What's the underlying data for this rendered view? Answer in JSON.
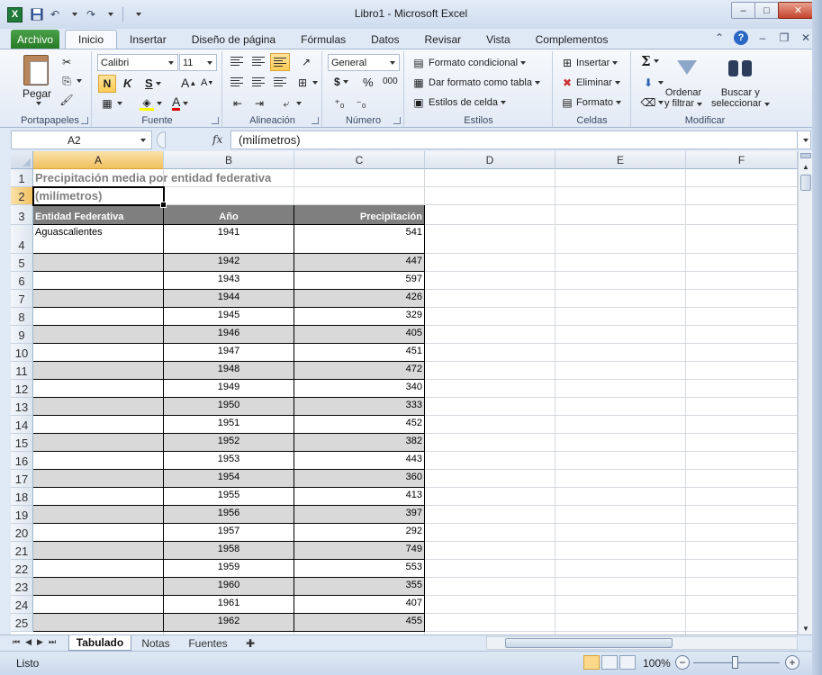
{
  "window": {
    "title": "Libro1  -  Microsoft Excel",
    "app_icon": "X"
  },
  "qat": {
    "save": "save-icon",
    "undo": "undo-icon",
    "redo": "redo-icon",
    "customize": "customize-icon"
  },
  "window_controls": {
    "minimize": "–",
    "maximize": "□",
    "close": "✕"
  },
  "tabs": [
    {
      "label": "Archivo"
    },
    {
      "label": "Inicio"
    },
    {
      "label": "Insertar"
    },
    {
      "label": "Diseño de página"
    },
    {
      "label": "Fórmulas"
    },
    {
      "label": "Datos"
    },
    {
      "label": "Revisar"
    },
    {
      "label": "Vista"
    },
    {
      "label": "Complementos"
    }
  ],
  "ribbon": {
    "clipboard": {
      "label": "Portapapeles",
      "paste": "Pegar"
    },
    "font": {
      "label": "Fuente",
      "name": "Calibri",
      "size": "11",
      "bold": "N",
      "italic": "K",
      "underline": "S",
      "grow": "A",
      "shrink": "A",
      "color_letter": "A"
    },
    "alignment": {
      "label": "Alineación"
    },
    "number": {
      "label": "Número",
      "format": "General",
      "currency": "$",
      "percent": "%",
      "thousands": "000"
    },
    "styles": {
      "label": "Estilos",
      "conditional": "Formato condicional",
      "as_table": "Dar formato como tabla",
      "cell_styles": "Estilos de celda"
    },
    "cells": {
      "label": "Celdas",
      "insert": "Insertar",
      "delete": "Eliminar",
      "format": "Formato"
    },
    "editing": {
      "label": "Modificar",
      "sort_1": "Ordenar",
      "sort_2": "y filtrar",
      "find_1": "Buscar y",
      "find_2": "seleccionar",
      "sigma": "Σ"
    }
  },
  "formula_bar": {
    "name_box": "A2",
    "fx": "fx",
    "content": "(milímetros)"
  },
  "columns": [
    "A",
    "B",
    "C",
    "D",
    "E",
    "F"
  ],
  "sheet": {
    "title": "Precipitación media por entidad federativa",
    "subtitle": "(milímetros)",
    "headers": [
      "Entidad Federativa",
      "Año",
      "Precipitación"
    ],
    "rows": [
      {
        "entity": "Aguascalientes",
        "year": "1941",
        "value": "541"
      },
      {
        "entity": "",
        "year": "1942",
        "value": "447"
      },
      {
        "entity": "",
        "year": "1943",
        "value": "597"
      },
      {
        "entity": "",
        "year": "1944",
        "value": "426"
      },
      {
        "entity": "",
        "year": "1945",
        "value": "329"
      },
      {
        "entity": "",
        "year": "1946",
        "value": "405"
      },
      {
        "entity": "",
        "year": "1947",
        "value": "451"
      },
      {
        "entity": "",
        "year": "1948",
        "value": "472"
      },
      {
        "entity": "",
        "year": "1949",
        "value": "340"
      },
      {
        "entity": "",
        "year": "1950",
        "value": "333"
      },
      {
        "entity": "",
        "year": "1951",
        "value": "452"
      },
      {
        "entity": "",
        "year": "1952",
        "value": "382"
      },
      {
        "entity": "",
        "year": "1953",
        "value": "443"
      },
      {
        "entity": "",
        "year": "1954",
        "value": "360"
      },
      {
        "entity": "",
        "year": "1955",
        "value": "413"
      },
      {
        "entity": "",
        "year": "1956",
        "value": "397"
      },
      {
        "entity": "",
        "year": "1957",
        "value": "292"
      },
      {
        "entity": "",
        "year": "1958",
        "value": "749"
      },
      {
        "entity": "",
        "year": "1959",
        "value": "553"
      },
      {
        "entity": "",
        "year": "1960",
        "value": "355"
      },
      {
        "entity": "",
        "year": "1961",
        "value": "407"
      },
      {
        "entity": "",
        "year": "1962",
        "value": "455"
      }
    ]
  },
  "row_numbers": [
    "1",
    "2",
    "3",
    "4",
    "5",
    "6",
    "7",
    "8",
    "9",
    "10",
    "11",
    "12",
    "13",
    "14",
    "15",
    "16",
    "17",
    "18",
    "19",
    "20",
    "21",
    "22",
    "23",
    "24",
    "25"
  ],
  "sheet_tabs": [
    {
      "label": "Tabulado"
    },
    {
      "label": "Notas"
    },
    {
      "label": "Fuentes"
    }
  ],
  "status": {
    "ready": "Listo",
    "zoom": "100%"
  }
}
